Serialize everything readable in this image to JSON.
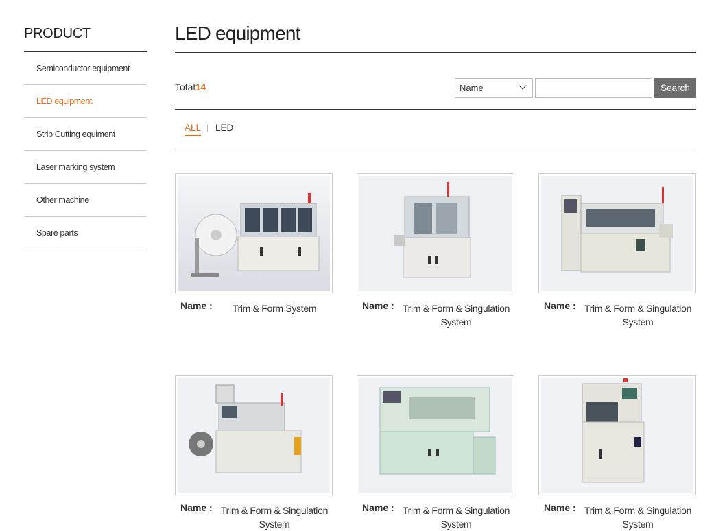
{
  "sidebar": {
    "title": "PRODUCT",
    "items": [
      {
        "label": "Semiconductor equipment",
        "active": false
      },
      {
        "label": "LED equipment",
        "active": true
      },
      {
        "label": "Strip Cutting equiment",
        "active": false
      },
      {
        "label": "Laser marking system",
        "active": false
      },
      {
        "label": "Other machine",
        "active": false
      },
      {
        "label": "Spare parts",
        "active": false
      }
    ]
  },
  "main": {
    "title": "LED equipment",
    "total_label": "Total",
    "total_count": "14",
    "search": {
      "select_value": "Name",
      "input_value": "",
      "button_label": "Search"
    },
    "tabs": [
      {
        "label": "ALL",
        "active": true
      },
      {
        "label": "LED",
        "active": false
      }
    ],
    "products": [
      {
        "name_label": "Name :",
        "name": "Trim & Form System"
      },
      {
        "name_label": "Name :",
        "name": "Trim & Form & Singulation System"
      },
      {
        "name_label": "Name :",
        "name": "Trim & Form & Singulation System"
      },
      {
        "name_label": "Name :",
        "name": "Trim & Form & Singulation System"
      },
      {
        "name_label": "Name :",
        "name": "Trim & Form & Singulation System"
      },
      {
        "name_label": "Name :",
        "name": "Trim & Form & Singulation System"
      }
    ]
  },
  "colors": {
    "accent": "#ea6b1e",
    "button": "#6d6d6d",
    "machine_light": "#e4e4de",
    "machine_green": "#cfe3d6"
  }
}
